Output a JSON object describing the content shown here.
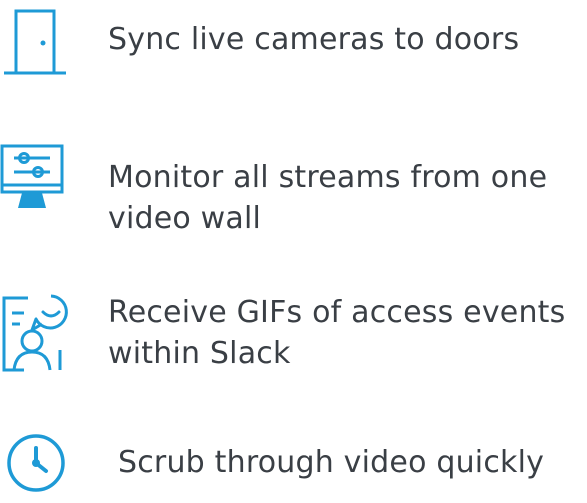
{
  "accent_color": "#1e9ad6",
  "text_color": "#3a3f45",
  "features": [
    {
      "icon": "door-icon",
      "lines": [
        "Sync live cameras to doors"
      ]
    },
    {
      "icon": "monitor-sliders-icon",
      "lines": [
        "Monitor all streams from one",
        "video wall"
      ]
    },
    {
      "icon": "chat-user-icon",
      "lines": [
        "Receive GIFs of access events",
        "within Slack"
      ]
    },
    {
      "icon": "clock-icon",
      "lines": [
        "Scrub through video quickly"
      ]
    }
  ]
}
